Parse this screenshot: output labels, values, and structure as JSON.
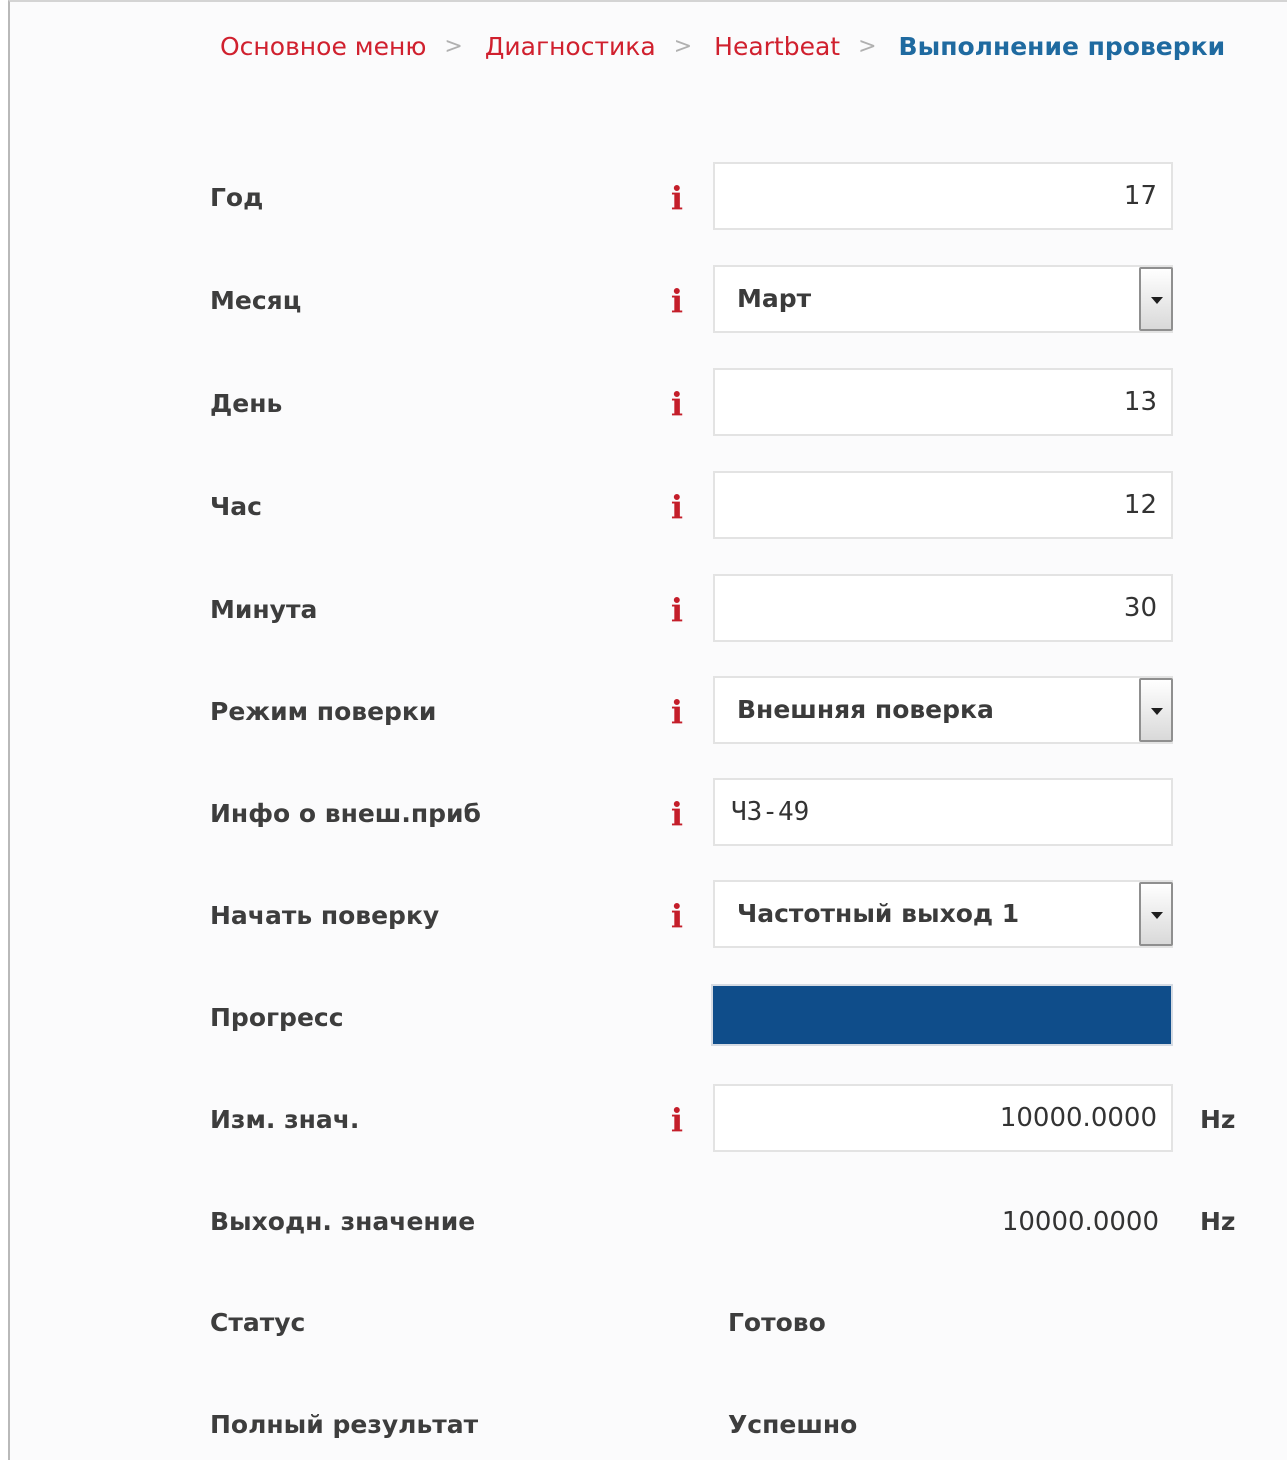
{
  "breadcrumb": {
    "items": [
      "Основное меню",
      "Диагностика",
      "Heartbeat"
    ],
    "separator": ">",
    "current": "Выполнение проверки"
  },
  "fields": {
    "year": {
      "label": "Год",
      "value": "17"
    },
    "month": {
      "label": "Месяц",
      "value": "Март"
    },
    "day": {
      "label": "День",
      "value": "13"
    },
    "hour": {
      "label": "Час",
      "value": "12"
    },
    "minute": {
      "label": "Минута",
      "value": "30"
    },
    "verification_mode": {
      "label": "Режим поверки",
      "value": "Внешняя поверка"
    },
    "external_device_info": {
      "label": "Инфо о внеш.приб",
      "value": "Ч3-49"
    },
    "start_verification": {
      "label": "Начать поверку",
      "value": "Частотный выход 1"
    },
    "progress": {
      "label": "Прогресс",
      "percent": 100
    },
    "measured_value": {
      "label": "Изм. знач.",
      "value": "10000.0000",
      "unit": "Hz"
    },
    "output_value": {
      "label": "Выходн. значение",
      "value": "10000.0000",
      "unit": "Hz"
    },
    "status": {
      "label": "Статус",
      "value": "Готово"
    },
    "overall_result": {
      "label": "Полный результат",
      "value": "Успешно"
    }
  },
  "icons": {
    "info": "i"
  },
  "colors": {
    "breadcrumb_link": "#d0202e",
    "breadcrumb_current": "#1f6aa0",
    "info_icon": "#c41e2a",
    "progress_fill": "#0f4d8a"
  }
}
